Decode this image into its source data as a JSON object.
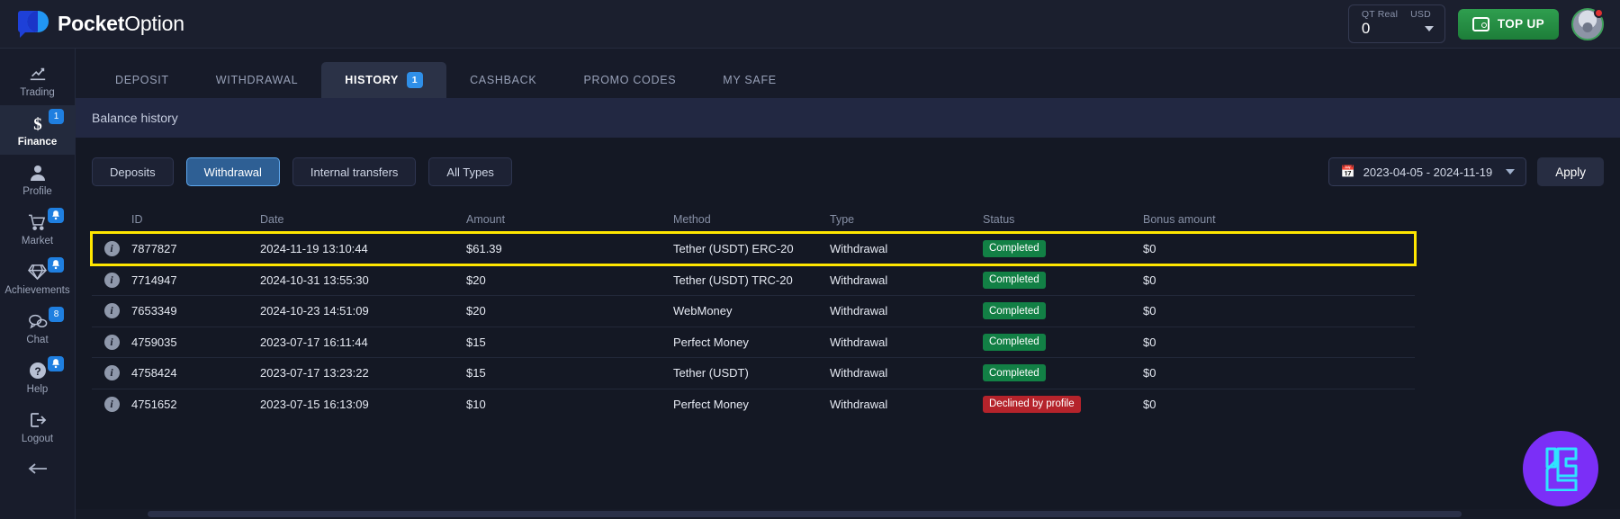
{
  "brand": {
    "name_bold": "Pocket",
    "name_light": "Option"
  },
  "header": {
    "balance_label": "QT Real",
    "currency": "USD",
    "balance_value": "0",
    "topup_label": "TOP UP"
  },
  "sidebar": {
    "items": [
      {
        "label": "Trading",
        "icon": "chart-line-icon",
        "badge": "",
        "badge_type": "none",
        "active": false
      },
      {
        "label": "Finance",
        "icon": "dollar-icon",
        "badge": "1",
        "badge_type": "number",
        "active": true
      },
      {
        "label": "Profile",
        "icon": "person-icon",
        "badge": "",
        "badge_type": "none",
        "active": false
      },
      {
        "label": "Market",
        "icon": "cart-icon",
        "badge": "♪",
        "badge_type": "bell",
        "active": false
      },
      {
        "label": "Achievements",
        "icon": "diamond-icon",
        "badge": "♪",
        "badge_type": "bell",
        "active": false
      },
      {
        "label": "Chat",
        "icon": "chat-bubble-icon",
        "badge": "8",
        "badge_type": "number",
        "active": false
      },
      {
        "label": "Help",
        "icon": "question-icon",
        "badge": "♪",
        "badge_type": "bell",
        "active": false
      },
      {
        "label": "Logout",
        "icon": "logout-icon",
        "badge": "",
        "badge_type": "none",
        "active": false
      }
    ],
    "collapse_icon": "arrow-left-icon"
  },
  "tabs": [
    {
      "label": "DEPOSIT",
      "badge": "",
      "active": false
    },
    {
      "label": "WITHDRAWAL",
      "badge": "",
      "active": false
    },
    {
      "label": "HISTORY",
      "badge": "1",
      "active": true
    },
    {
      "label": "CASHBACK",
      "badge": "",
      "active": false
    },
    {
      "label": "PROMO CODES",
      "badge": "",
      "active": false
    },
    {
      "label": "MY SAFE",
      "badge": "",
      "active": false
    }
  ],
  "panel": {
    "title": "Balance history",
    "filters": [
      {
        "label": "Deposits",
        "active": false
      },
      {
        "label": "Withdrawal",
        "active": true
      },
      {
        "label": "Internal transfers",
        "active": false
      },
      {
        "label": "All Types",
        "active": false
      }
    ],
    "date_range": "2023-04-05 - 2024-11-19",
    "apply_label": "Apply"
  },
  "table": {
    "columns": [
      "ID",
      "Date",
      "Amount",
      "Method",
      "Type",
      "Status",
      "Bonus amount"
    ],
    "rows": [
      {
        "id": "7877827",
        "date": "2024-11-19 13:10:44",
        "amount": "$61.39",
        "method": "Tether (USDT) ERC-20",
        "type": "Withdrawal",
        "status": "Completed",
        "status_kind": "ok",
        "bonus": "$0",
        "highlighted": true
      },
      {
        "id": "7714947",
        "date": "2024-10-31 13:55:30",
        "amount": "$20",
        "method": "Tether (USDT) TRC-20",
        "type": "Withdrawal",
        "status": "Completed",
        "status_kind": "ok",
        "bonus": "$0",
        "highlighted": false
      },
      {
        "id": "7653349",
        "date": "2024-10-23 14:51:09",
        "amount": "$20",
        "method": "WebMoney",
        "type": "Withdrawal",
        "status": "Completed",
        "status_kind": "ok",
        "bonus": "$0",
        "highlighted": false
      },
      {
        "id": "4759035",
        "date": "2023-07-17 16:11:44",
        "amount": "$15",
        "method": "Perfect Money",
        "type": "Withdrawal",
        "status": "Completed",
        "status_kind": "ok",
        "bonus": "$0",
        "highlighted": false
      },
      {
        "id": "4758424",
        "date": "2023-07-17 13:23:22",
        "amount": "$15",
        "method": "Tether (USDT)",
        "type": "Withdrawal",
        "status": "Completed",
        "status_kind": "ok",
        "bonus": "$0",
        "highlighted": false
      },
      {
        "id": "4751652",
        "date": "2023-07-15 16:13:09",
        "amount": "$10",
        "method": "Perfect Money",
        "type": "Withdrawal",
        "status": "Declined by profile",
        "status_kind": "bad",
        "bonus": "$0",
        "highlighted": false
      }
    ]
  },
  "floating_widget": {
    "icon": "lc-monogram-icon",
    "color": "#7b2ff7"
  },
  "colors": {
    "accent_blue": "#2f8fe8",
    "success_green": "#128045",
    "danger_red": "#b5232b",
    "topup_green": "#2f9e4f",
    "highlight_yellow": "#ffe600"
  }
}
